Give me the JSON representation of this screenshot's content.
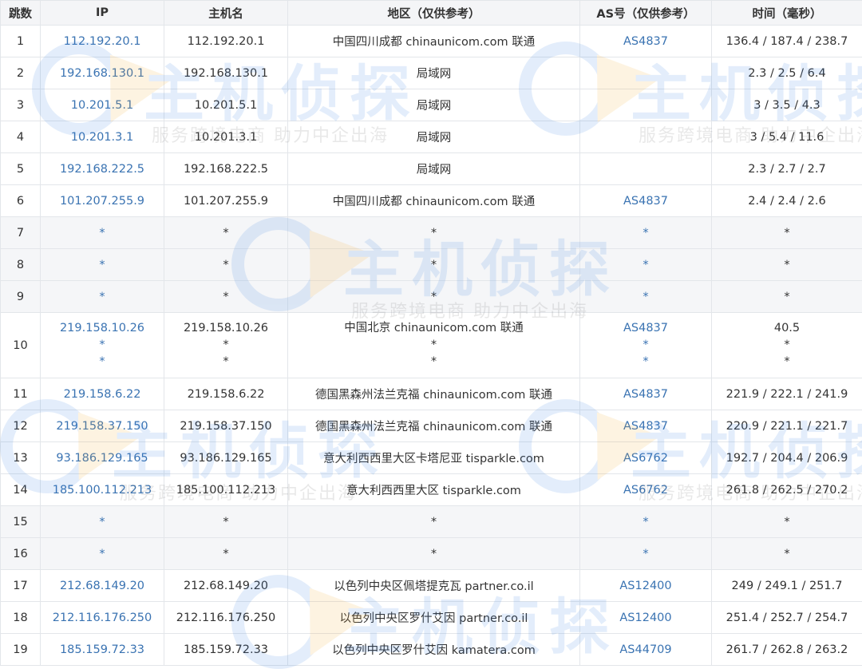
{
  "headers": {
    "hop": "跳数",
    "ip": "IP",
    "host": "主机名",
    "region": "地区（仅供参考）",
    "asn": "AS号（仅供参考）",
    "time": "时间（毫秒）"
  },
  "rows": [
    {
      "hop": "1",
      "ip": "112.192.20.1",
      "host": "112.192.20.1",
      "region": "中国四川成都 chinaunicom.com 联通",
      "asn": "AS4837",
      "time": "136.4 / 187.4 / 238.7"
    },
    {
      "hop": "2",
      "ip": "192.168.130.1",
      "host": "192.168.130.1",
      "region": "局域网",
      "asn": "",
      "time": "2.3 / 2.5 / 6.4"
    },
    {
      "hop": "3",
      "ip": "10.201.5.1",
      "host": "10.201.5.1",
      "region": "局域网",
      "asn": "",
      "time": "3 / 3.5 / 4.3"
    },
    {
      "hop": "4",
      "ip": "10.201.3.1",
      "host": "10.201.3.1",
      "region": "局域网",
      "asn": "",
      "time": "3 / 5.4 / 11.6"
    },
    {
      "hop": "5",
      "ip": "192.168.222.5",
      "host": "192.168.222.5",
      "region": "局域网",
      "asn": "",
      "time": "2.3 / 2.7 / 2.7"
    },
    {
      "hop": "6",
      "ip": "101.207.255.9",
      "host": "101.207.255.9",
      "region": "中国四川成都 chinaunicom.com 联通",
      "asn": "AS4837",
      "time": "2.4 / 2.4 / 2.6"
    },
    {
      "hop": "7",
      "ip": "*",
      "host": "*",
      "region": "*",
      "asn": "*",
      "time": "*"
    },
    {
      "hop": "8",
      "ip": "*",
      "host": "*",
      "region": "*",
      "asn": "*",
      "time": "*"
    },
    {
      "hop": "9",
      "ip": "*",
      "host": "*",
      "region": "*",
      "asn": "*",
      "time": "*"
    },
    {
      "hop": "11",
      "ip": "219.158.6.22",
      "host": "219.158.6.22",
      "region": "德国黑森州法兰克福 chinaunicom.com 联通",
      "asn": "AS4837",
      "time": "221.9 / 222.1 / 241.9"
    },
    {
      "hop": "12",
      "ip": "219.158.37.150",
      "host": "219.158.37.150",
      "region": "德国黑森州法兰克福 chinaunicom.com 联通",
      "asn": "AS4837",
      "time": "220.9 / 221.1 / 221.7"
    },
    {
      "hop": "13",
      "ip": "93.186.129.165",
      "host": "93.186.129.165",
      "region": "意大利西西里大区卡塔尼亚 tisparkle.com",
      "asn": "AS6762",
      "time": "192.7 / 204.4 / 206.9"
    },
    {
      "hop": "14",
      "ip": "185.100.112.213",
      "host": "185.100.112.213",
      "region": "意大利西西里大区 tisparkle.com",
      "asn": "AS6762",
      "time": "261.8 / 262.5 / 270.2"
    },
    {
      "hop": "15",
      "ip": "*",
      "host": "*",
      "region": "*",
      "asn": "*",
      "time": "*"
    },
    {
      "hop": "16",
      "ip": "*",
      "host": "*",
      "region": "*",
      "asn": "*",
      "time": "*"
    },
    {
      "hop": "17",
      "ip": "212.68.149.20",
      "host": "212.68.149.20",
      "region": "以色列中央区佩塔提克瓦 partner.co.il",
      "asn": "AS12400",
      "time": "249 / 249.1 / 251.7"
    },
    {
      "hop": "18",
      "ip": "212.116.176.250",
      "host": "212.116.176.250",
      "region": "以色列中央区罗什艾因 partner.co.il",
      "asn": "AS12400",
      "time": "251.4 / 252.7 / 254.7"
    },
    {
      "hop": "19",
      "ip": "185.159.72.33",
      "host": "185.159.72.33",
      "region": "以色列中央区罗什艾因 kamatera.com",
      "asn": "AS44709",
      "time": "261.7 / 262.8 / 263.2"
    }
  ],
  "multi_row": {
    "hop": "10",
    "ip": [
      "219.158.10.26",
      "*",
      "*"
    ],
    "host": [
      "219.158.10.26",
      "*",
      "*"
    ],
    "region": [
      "中国北京 chinaunicom.com 联通",
      "*",
      "*"
    ],
    "asn": [
      "AS4837",
      "*",
      "*"
    ],
    "time": [
      "40.5",
      "*",
      "*"
    ]
  },
  "watermark": {
    "brand": "主机侦探",
    "slogan": "服务跨境电商  助力中企出海",
    "brand_color": "#2f7de1",
    "accent_color": "#f5a623",
    "icon": "magnifier-logo-icon"
  },
  "colors": {
    "link": "#3a73b2",
    "header_bg": "#f4f5f7",
    "stripe_bg": "#f5f6f8",
    "border": "#e3e6ea"
  }
}
